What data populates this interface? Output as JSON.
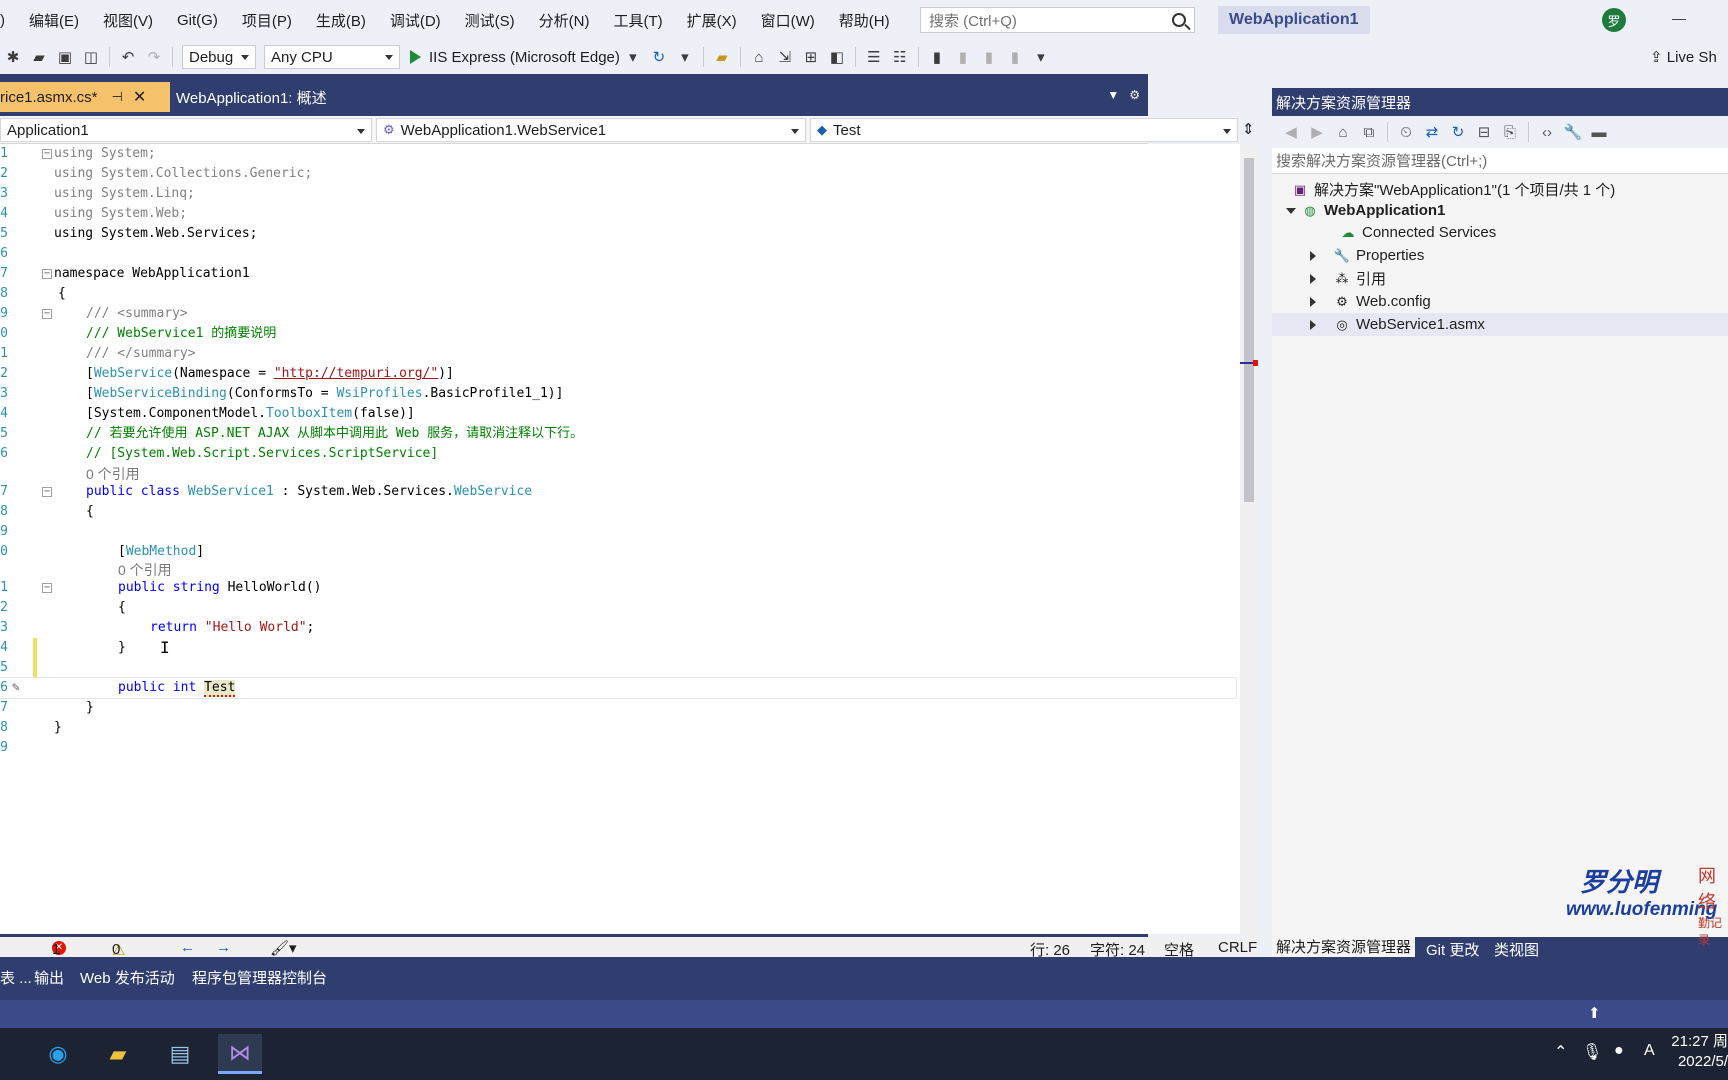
{
  "menubar": {
    "items": [
      ")",
      "编辑(E)",
      "视图(V)",
      "Git(G)",
      "项目(P)",
      "生成(B)",
      "调试(D)",
      "测试(S)",
      "分析(N)",
      "工具(T)",
      "扩展(X)",
      "窗口(W)",
      "帮助(H)"
    ],
    "search_placeholder": "搜索 (Ctrl+Q)",
    "solution_title": "WebApplication1",
    "avatar_initial": "罗"
  },
  "toolbar": {
    "config": "Debug",
    "platform": "Any CPU",
    "run_target": "IIS Express (Microsoft Edge)",
    "live_share": "Live Sh"
  },
  "tabs": {
    "active": "rice1.asmx.cs*",
    "inactive": "WebApplication1: 概述"
  },
  "navbar": {
    "project": "Application1",
    "class": "WebApplication1.WebService1",
    "member": "Test"
  },
  "code": {
    "l1": "using System;",
    "l2": "using System.Collections.Generic;",
    "l3": "using System.Linq;",
    "l4": "using System.Web;",
    "l5": "using System.Web.Services;",
    "l7": "namespace WebApplication1",
    "l8": "{",
    "l9": "/// <summary>",
    "l10": "/// WebService1 的摘要说明",
    "l11": "/// </summary>",
    "l12a": "[",
    "l12b": "WebService",
    "l12c": "(Namespace = ",
    "l12d": "\"http://tempuri.org/\"",
    "l12e": ")]",
    "l13a": "[",
    "l13b": "WebServiceBinding",
    "l13c": "(ConformsTo = ",
    "l13d": "WsiProfiles",
    "l13e": ".BasicProfile1_1)]",
    "l14a": "[System.ComponentModel.",
    "l14b": "ToolboxItem",
    "l14c": "(false)]",
    "l15": "// 若要允许使用 ASP.NET AJAX 从脚本中调用此 Web 服务，请取消注释以下行。",
    "l16": "// [System.Web.Script.Services.ScriptService]",
    "lens1": "0 个引用",
    "l17a": "public class ",
    "l17b": "WebService1",
    "l17c": " : System.Web.Services.",
    "l17d": "WebService",
    "l18": "{",
    "l20a": "[",
    "l20b": "WebMethod",
    "l20c": "]",
    "lens2": "0 个引用",
    "l21a": "public string ",
    "l21b": "HelloWorld()",
    "l22": "{",
    "l23a": "return ",
    "l23b": "\"Hello World\"",
    "l23c": ";",
    "l24": "}",
    "l26a": "public int ",
    "l26b": "Test",
    "l27": "}",
    "l28": "}"
  },
  "line_numbers": [
    "1",
    "2",
    "3",
    "4",
    "5",
    "6",
    "7",
    "8",
    "9",
    "0",
    "1",
    "2",
    "3",
    "4",
    "5",
    "6",
    "7",
    "8",
    "9",
    "0",
    "1",
    "2",
    "3",
    "4",
    "5",
    "6",
    "7",
    "8",
    "9"
  ],
  "status": {
    "errors": "1",
    "warnings": "0",
    "line": "行: 26",
    "char": "字符: 24",
    "space": "空格",
    "eol": "CRLF"
  },
  "solution_explorer": {
    "title": "解决方案资源管理器",
    "search_placeholder": "搜索解决方案资源管理器(Ctrl+;)",
    "items": [
      "解决方案\"WebApplication1\"(1 个项目/共 1 个)",
      "WebApplication1",
      "Connected Services",
      "Properties",
      "引用",
      "Web.config",
      "WebService1.asmx"
    ],
    "bottom_tabs": [
      "解决方案资源管理器",
      "Git 更改",
      "类视图"
    ]
  },
  "watermark": {
    "name": "罗分明",
    "side": "网络",
    "side2": "勤记录",
    "url": "www.luofenming"
  },
  "output_tabs": [
    "表 ...",
    "输出",
    "Web 发布活动",
    "程序包管理器控制台"
  ],
  "taskbar": {
    "time": "21:27 周",
    "date": "2022/5/"
  }
}
